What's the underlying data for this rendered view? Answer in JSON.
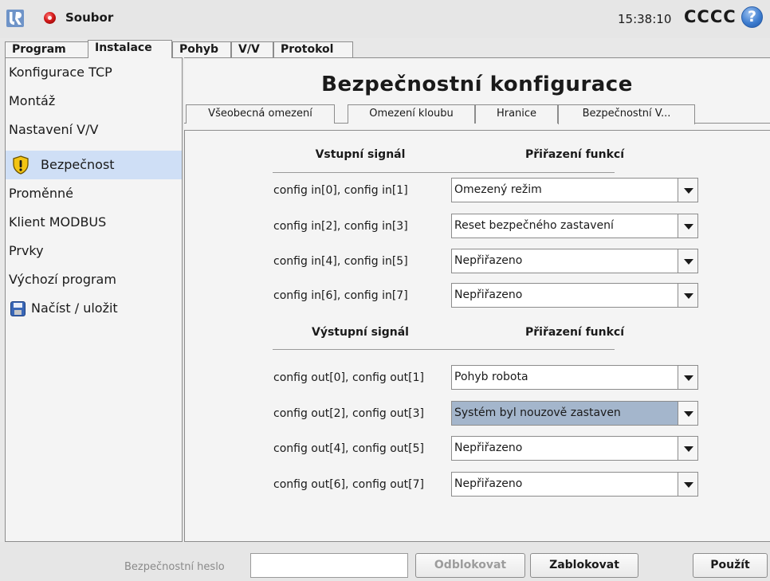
{
  "topbar": {
    "file_menu_label": "Soubor",
    "time": "15:38:10",
    "robot_name": "CCCC",
    "help_symbol": "?",
    "logo_icon": "ur-logo-icon",
    "status_icon": "power-status-red-icon"
  },
  "main_tabs": [
    {
      "label": "Program",
      "active": false
    },
    {
      "label": "Instalace",
      "active": true
    },
    {
      "label": "Pohyb",
      "active": false
    },
    {
      "label": "V/V",
      "active": false
    },
    {
      "label": "Protokol",
      "active": false
    }
  ],
  "sidebar": {
    "items": [
      {
        "label": "Konfigurace TCP",
        "selected": false
      },
      {
        "label": "Montáž",
        "selected": false
      },
      {
        "label": "Nastavení V/V",
        "selected": false
      },
      {
        "label": "Bezpečnost",
        "selected": true,
        "icon": "shield-warning-icon"
      },
      {
        "label": "Proměnné",
        "selected": false
      },
      {
        "label": "Klient MODBUS",
        "selected": false
      },
      {
        "label": "Prvky",
        "selected": false
      },
      {
        "label": "Výchozí program",
        "selected": false
      },
      {
        "label": "Načíst / uložit",
        "selected": false,
        "icon": "floppy-disk-icon"
      }
    ]
  },
  "main": {
    "title": "Bezpečnostní konfigurace",
    "sub_tabs": [
      {
        "label": "Všeobecná omezení",
        "active": false
      },
      {
        "label": "Omezení kloubu",
        "active": false
      },
      {
        "label": "Hranice",
        "active": false
      },
      {
        "label": "Bezpečnostní V...",
        "active": true
      }
    ],
    "inputs": {
      "signal_header": "Vstupní signál",
      "function_header": "Přiřazení funkcí",
      "rows": [
        {
          "signal": "config in[0], config in[1]",
          "function": "Omezený režim"
        },
        {
          "signal": "config in[2], config in[3]",
          "function": "Reset bezpečného zastavení"
        },
        {
          "signal": "config in[4], config in[5]",
          "function": "Nepřiřazeno"
        },
        {
          "signal": "config in[6], config in[7]",
          "function": "Nepřiřazeno"
        }
      ]
    },
    "outputs": {
      "signal_header": "Výstupní signál",
      "function_header": "Přiřazení funkcí",
      "rows": [
        {
          "signal": "config out[0], config out[1]",
          "function": "Pohyb robota"
        },
        {
          "signal": "config out[2], config out[3]",
          "function": "Systém byl nouzově zastaven",
          "highlighted": true
        },
        {
          "signal": "config out[4], config out[5]",
          "function": "Nepřiřazeno"
        },
        {
          "signal": "config out[6], config out[7]",
          "function": "Nepřiřazeno"
        }
      ]
    }
  },
  "bottom": {
    "password_label": "Bezpečnostní heslo",
    "password_value": "",
    "unlock_label": "Odblokovat",
    "lock_label": "Zablokovat",
    "apply_label": "Použít"
  },
  "colors": {
    "selected_item_bg": "#cfdff6",
    "highlighted_dropdown_bg": "#a4b6cc",
    "status_red": "#d41a1a",
    "help_blue": "#3f7ed0",
    "shield_yellow": "#f2c414"
  }
}
